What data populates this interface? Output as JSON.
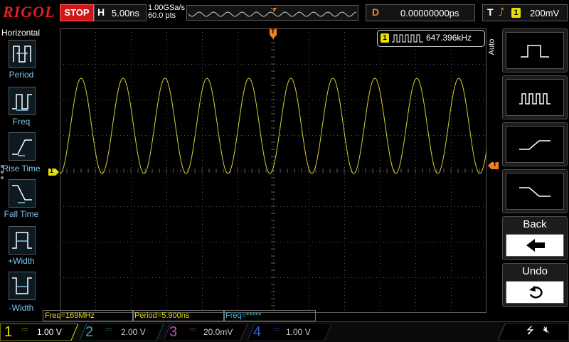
{
  "top": {
    "brand": "RIGOL",
    "run_state": "STOP",
    "horizontal_key": "H",
    "timebase": "5.00ns",
    "sample_rate": "1.00GSa/s",
    "memory_depth": "60.0 pts",
    "trigger_position_marker": "T",
    "delay_key": "D",
    "delay_value": "0.00000000ps",
    "trigger_key": "T",
    "trigger_source": "1",
    "trigger_level": "200mV"
  },
  "left_menu": {
    "title": "Horizontal",
    "items": [
      {
        "label": "Period",
        "icon": "period-icon"
      },
      {
        "label": "Freq",
        "icon": "freq-icon"
      },
      {
        "label": "Rise Time",
        "icon": "rise-time-icon"
      },
      {
        "label": "Fall Time",
        "icon": "fall-time-icon"
      },
      {
        "label": "+Width",
        "icon": "positive-width-icon"
      },
      {
        "label": "-Width",
        "icon": "negative-width-icon"
      }
    ]
  },
  "screen": {
    "channel_marker": "1",
    "trigger_level_marker": "T",
    "counter_source": "1",
    "counter_value": "647.396kHz"
  },
  "right_menu": {
    "tab_label": "Auto",
    "buttons": [
      {
        "name": "single-pulse",
        "icon": "single-pulse-icon"
      },
      {
        "name": "pulse-train",
        "icon": "pulse-train-icon"
      },
      {
        "name": "rising-edge",
        "icon": "rising-edge-icon"
      },
      {
        "name": "falling-edge",
        "icon": "falling-edge-icon"
      }
    ],
    "back_label": "Back",
    "undo_label": "Undo"
  },
  "measurements": [
    {
      "text": "Freq=169MHz",
      "color": "#e8e000"
    },
    {
      "text": "Period=5.900ns",
      "color": "#e8e000"
    },
    {
      "text": "Freq=*****",
      "color": "#30c8e8"
    }
  ],
  "channels": [
    {
      "num": "1",
      "value": "1.00 V",
      "color": "#e8e000",
      "active": true
    },
    {
      "num": "2",
      "value": "2.00 V",
      "color": "#30a8b8",
      "active": false
    },
    {
      "num": "3",
      "value": "20.0mV",
      "color": "#c050c0",
      "active": false
    },
    {
      "num": "4",
      "value": "1.00 V",
      "color": "#3060d0",
      "active": false
    }
  ],
  "colors": {
    "ch1": "#e8e000",
    "trigger": "#f08020",
    "accent": "#7dc8ee"
  }
}
